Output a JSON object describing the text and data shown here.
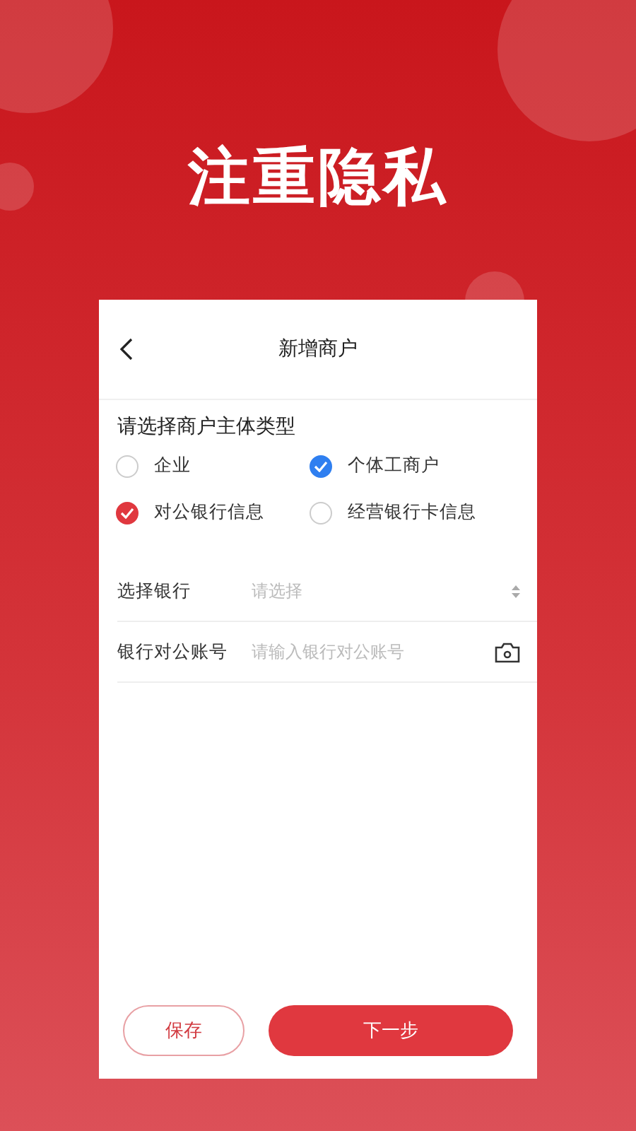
{
  "headline": "注重隐私",
  "screen": {
    "title": "新增商户",
    "section_title": "请选择商户主体类型",
    "entity_types": [
      {
        "label": "企业",
        "selected": false
      },
      {
        "label": "个体工商户",
        "selected": true
      }
    ],
    "account_types": [
      {
        "label": "对公银行信息",
        "selected": true
      },
      {
        "label": "经营银行卡信息",
        "selected": false
      }
    ],
    "fields": [
      {
        "kind": "select",
        "label": "选择银行",
        "placeholder": "请选择"
      },
      {
        "kind": "camera",
        "label": "银行对公账号",
        "placeholder": "请输入银行对公账号"
      }
    ],
    "buttons": [
      {
        "kind": "outline",
        "label": "保存"
      },
      {
        "kind": "primary",
        "label": "下一步"
      }
    ]
  }
}
